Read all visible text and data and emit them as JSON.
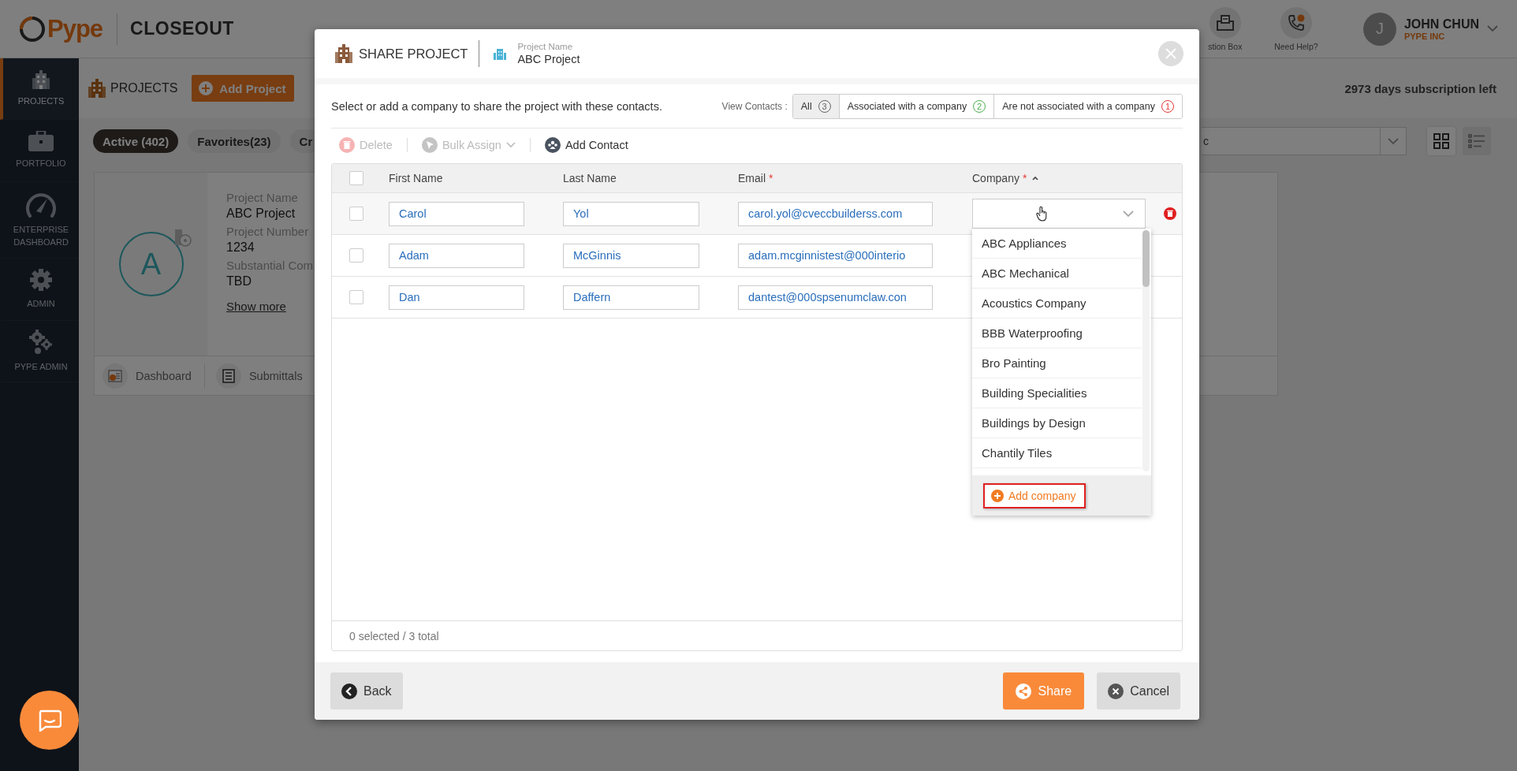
{
  "app": {
    "logo": "Pype",
    "module": "CLOSEOUT"
  },
  "header": {
    "actions": [
      {
        "kind": "question-box",
        "label": "stion Box"
      },
      {
        "kind": "help",
        "label": "Need Help?"
      }
    ],
    "user": {
      "initial": "J",
      "name": "JOHN CHUN",
      "company": "PYPE INC"
    }
  },
  "sidebar": {
    "items": [
      {
        "kind": "projects",
        "label": "PROJECTS",
        "selected": true
      },
      {
        "kind": "portfolio",
        "label": "PORTFOLIO",
        "selected": false
      },
      {
        "kind": "dashboard",
        "label": "ENTERPRISE DASHBOARD",
        "selected": false
      },
      {
        "kind": "admin",
        "label": "ADMIN",
        "selected": false
      },
      {
        "kind": "pype-admin",
        "label": "PYPE ADMIN",
        "selected": false
      }
    ]
  },
  "projects_page": {
    "title": "PROJECTS",
    "add_button": "Add Project",
    "subscription": "2973 days subscription left",
    "filters": [
      {
        "label": "Active (402)",
        "selected": true
      },
      {
        "label": "Favorites(23)",
        "selected": false
      },
      {
        "label": "Cr",
        "selected": false
      }
    ],
    "sort_value": "c",
    "view_modes": [
      {
        "kind": "grid",
        "selected": true
      },
      {
        "kind": "list",
        "selected": false
      }
    ],
    "card": {
      "avatar": "A",
      "fields": [
        {
          "label": "Project Name",
          "value": "ABC Project"
        },
        {
          "label": "Project Number",
          "value": "1234"
        },
        {
          "label": "Substantial Com",
          "value": "TBD"
        }
      ],
      "more_link": "Show more",
      "links": [
        {
          "kind": "dashboard",
          "label": "Dashboard"
        },
        {
          "kind": "submittals",
          "label": "Submittals"
        }
      ]
    }
  },
  "share_dialog": {
    "title": "SHARE PROJECT",
    "project_label": "Project Name",
    "project_name": "ABC Project",
    "instruction": "Select or add a company to share the project with these contacts.",
    "view_label": "View Contacts :",
    "view_filters": [
      {
        "label": "All",
        "count": "3",
        "color": "#666666",
        "selected": true
      },
      {
        "label": "Associated with a company",
        "count": "2",
        "color": "#4caf50",
        "selected": false
      },
      {
        "label": "Are not associated with a company",
        "count": "1",
        "color": "#e53935",
        "selected": false
      }
    ],
    "toolbar": [
      {
        "kind": "delete",
        "label": "Delete",
        "disabled": true
      },
      {
        "kind": "bulk-assign",
        "label": "Bulk Assign",
        "disabled": true
      },
      {
        "kind": "add-contact",
        "label": "Add Contact",
        "disabled": false
      }
    ],
    "select_all_checked": false,
    "columns": [
      {
        "label": "First Name"
      },
      {
        "label": "Last Name"
      },
      {
        "label": "Email",
        "marker": "*"
      },
      {
        "label": "Company",
        "marker": "*",
        "sort_ascending": true
      }
    ],
    "rows": [
      {
        "first_name": "Carol",
        "last_name": "Yol",
        "email": "carol.yol@cveccbuilderss.com",
        "checked": false,
        "hovered": true,
        "company_open": true
      },
      {
        "first_name": "Adam",
        "last_name": "McGinnis",
        "email": "adam.mcginnistest@000interio",
        "checked": false,
        "hovered": false,
        "company_open": false
      },
      {
        "first_name": "Dan",
        "last_name": "Daffern",
        "email": "dantest@000spsenumclaw.con",
        "checked": false,
        "hovered": false,
        "company_open": false
      }
    ],
    "company_options": [
      "ABC Appliances",
      "ABC Mechanical",
      "Acoustics Company",
      "BBB Waterproofing",
      "Bro Painting",
      "Building Specialities",
      "Buildings by Design",
      "Chantily Tiles"
    ],
    "add_company": {
      "label": "Add company",
      "outlined": true
    },
    "summary": "0 selected / 3 total",
    "buttons": [
      {
        "kind": "back",
        "label": "Back"
      },
      {
        "kind": "share",
        "label": "Share"
      },
      {
        "kind": "cancel",
        "label": "Cancel"
      }
    ]
  }
}
